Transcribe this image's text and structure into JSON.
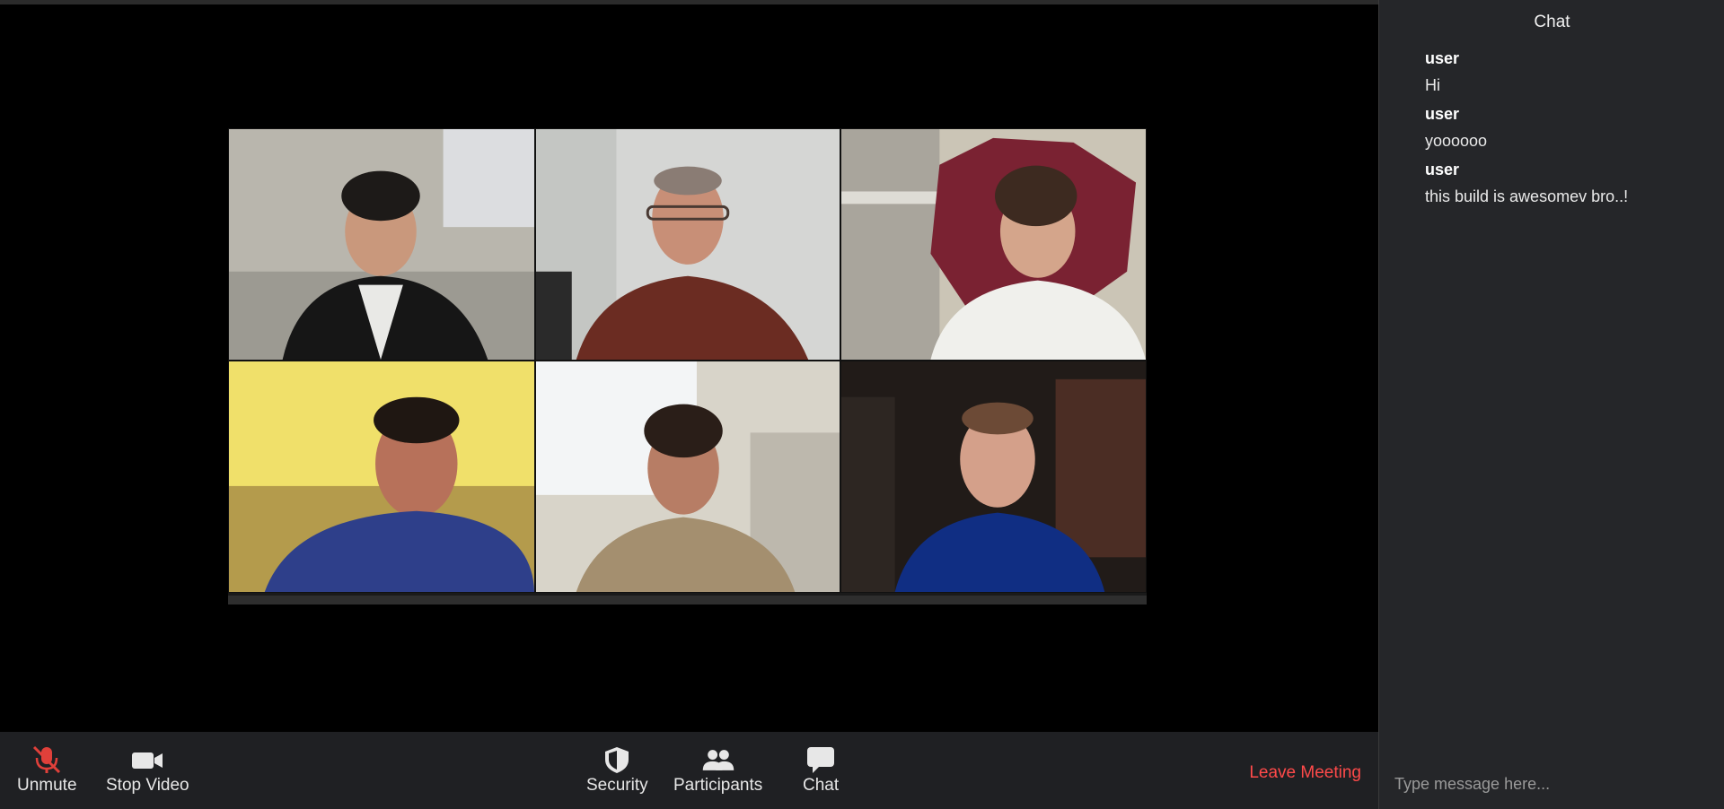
{
  "toolbar": {
    "unmute_label": "Unmute",
    "stop_video_label": "Stop Video",
    "security_label": "Security",
    "participants_label": "Participants",
    "chat_label": "Chat",
    "leave_label": "Leave Meeting",
    "icons": {
      "unmute": "microphone-muted-icon",
      "stop_video": "video-camera-icon",
      "security": "shield-icon",
      "participants": "participants-icon",
      "chat": "chat-bubble-icon"
    }
  },
  "chat": {
    "title": "Chat",
    "messages": [
      {
        "sender": "user",
        "text": "Hi"
      },
      {
        "sender": "user",
        "text": "yoooooo"
      },
      {
        "sender": "user",
        "text": "this build is awesomev bro..!"
      }
    ],
    "input_placeholder": "Type message here..."
  },
  "colors": {
    "leave": "#ff4a4a",
    "muted_mic": "#e0403a",
    "toolbar_bg": "#1f2023",
    "chat_bg": "#252629"
  }
}
